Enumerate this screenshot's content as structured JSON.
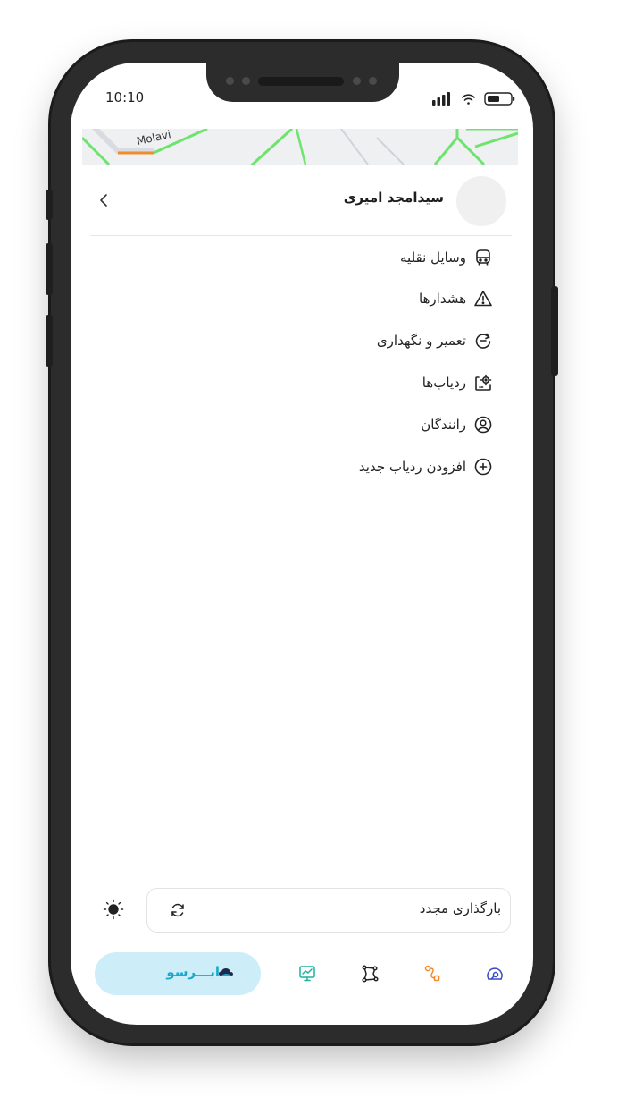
{
  "status_bar": {
    "time": "10:10"
  },
  "map": {
    "street_label": "Molavi"
  },
  "header": {
    "user_name": "سیدامجد امیری"
  },
  "menu": {
    "items": [
      {
        "label": "وسایل نقلیه",
        "icon": "bus-icon"
      },
      {
        "label": "هشدارها",
        "icon": "warning-icon"
      },
      {
        "label": "تعمیر و نگهداری",
        "icon": "maintenance-icon"
      },
      {
        "label": "ردیاب‌ها",
        "icon": "tracker-icon"
      },
      {
        "label": "رانندگان",
        "icon": "driver-icon"
      },
      {
        "label": "افزودن ردیاب جدید",
        "icon": "add-circle-icon"
      }
    ]
  },
  "reload": {
    "label": "بارگذاری مجدد"
  },
  "bottom_nav": {
    "brand_label": "ابـــرسو",
    "items": [
      "presentation-icon",
      "route-icon",
      "tracking-icon",
      "dashboard-icon"
    ]
  },
  "colors": {
    "brand_pill": "#cdeef8",
    "brand_text": "#1ba8cf",
    "map_road": "#6ee36e",
    "accent_orange": "#f28b30"
  }
}
